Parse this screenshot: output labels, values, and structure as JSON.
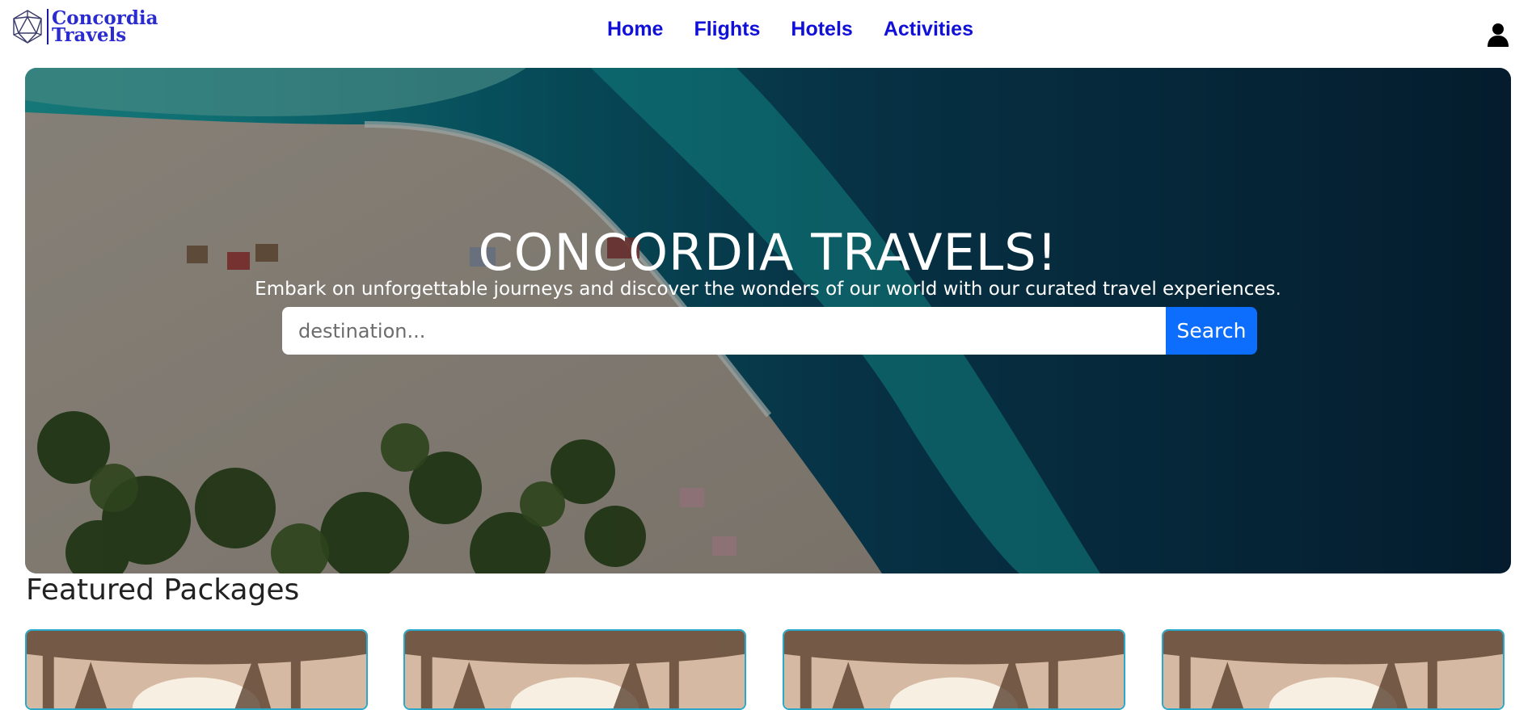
{
  "brand": {
    "name_line1": "Concordia",
    "name_line2": "Travels"
  },
  "nav": {
    "items": [
      {
        "label": "Home"
      },
      {
        "label": "Flights"
      },
      {
        "label": "Hotels"
      },
      {
        "label": "Activities"
      }
    ],
    "user_icon": "user-icon"
  },
  "hero": {
    "title": "CONCORDIA TRAVELS!",
    "subtitle": "Embark on unforgettable journeys and discover the wonders of our world with our curated travel experiences.",
    "search": {
      "placeholder": "destination...",
      "value": "",
      "button_label": "Search"
    }
  },
  "featured": {
    "heading": "Featured Packages",
    "cards": [
      {
        "image": "tropical-palm-sunset"
      },
      {
        "image": "tropical-palm-sunset"
      },
      {
        "image": "tropical-palm-sunset"
      },
      {
        "image": "tropical-palm-sunset"
      }
    ]
  },
  "colors": {
    "nav_link": "#1010d8",
    "brand": "#2b2bd0",
    "primary_button": "#0d6efd",
    "card_border": "#2aa7c9"
  }
}
